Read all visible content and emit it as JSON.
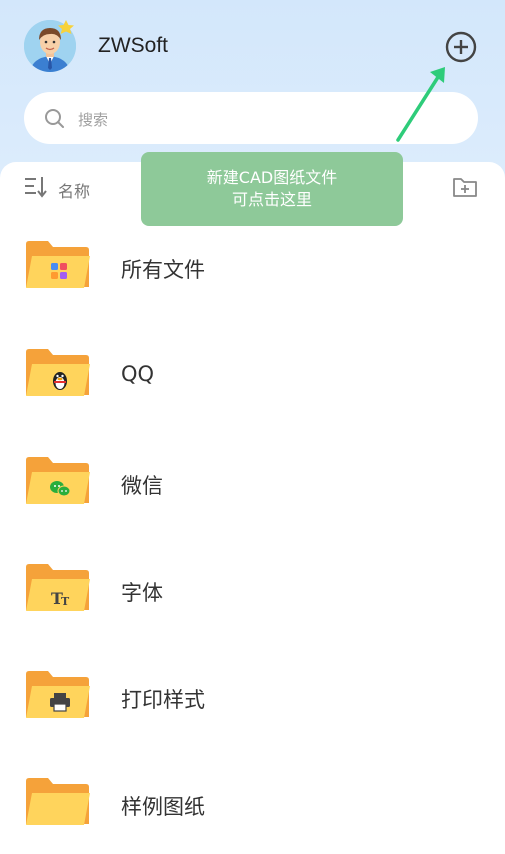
{
  "header": {
    "username": "ZWSoft"
  },
  "search": {
    "placeholder": "搜索"
  },
  "sort": {
    "label": "名称"
  },
  "tooltip": {
    "line1": "新建CAD图纸文件",
    "line2": "可点击这里"
  },
  "folders": [
    {
      "label": "所有文件",
      "icon": "grid-apps-icon"
    },
    {
      "label": "QQ",
      "icon": "qq-penguin-icon"
    },
    {
      "label": "微信",
      "icon": "wechat-icon"
    },
    {
      "label": "字体",
      "icon": "font-icon"
    },
    {
      "label": "打印样式",
      "icon": "printer-icon"
    },
    {
      "label": "样例图纸",
      "icon": "folder-icon"
    }
  ],
  "colors": {
    "header_bg": "#d3e7fb",
    "tooltip_bg": "#8ec999",
    "arrow": "#2ecc7a",
    "folder_back": "#f5a23a",
    "folder_front": "#ffd45c"
  }
}
